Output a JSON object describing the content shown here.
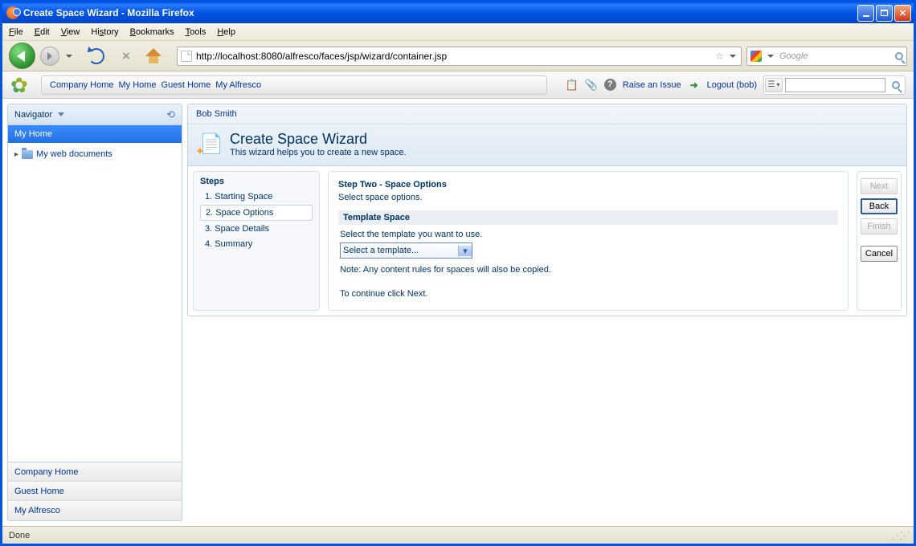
{
  "window": {
    "title": "Create Space Wizard - Mozilla Firefox"
  },
  "menubar": {
    "file": "File",
    "edit": "Edit",
    "view": "View",
    "history": "History",
    "bookmarks": "Bookmarks",
    "tools": "Tools",
    "help": "Help"
  },
  "url": "http://localhost:8080/alfresco/faces/jsp/wizard/container.jsp",
  "search_placeholder": "Google",
  "breadcrumbs": [
    "Company Home",
    "My Home",
    "Guest Home",
    "My Alfresco"
  ],
  "top_tools": {
    "raise_issue": "Raise an Issue",
    "logout": "Logout (bob)"
  },
  "sidebar": {
    "header": "Navigator",
    "active": "My Home",
    "tree_item": "My web documents",
    "bottom_links": [
      "Company Home",
      "Guest Home",
      "My Alfresco"
    ]
  },
  "main": {
    "breadcrumb": "Bob Smith",
    "title": "Create Space Wizard",
    "subtitle": "This wizard helps you to create a new space.",
    "steps_title": "Steps",
    "steps": [
      "1. Starting Space",
      "2. Space Options",
      "3. Space Details",
      "4. Summary"
    ],
    "active_step_index": 1,
    "step_title": "Step Two - Space Options",
    "step_desc": "Select space options.",
    "section_title": "Template Space",
    "instruction": "Select the template you want to use.",
    "select_value": "Select a template...",
    "note": "Note: Any content rules for spaces will also be copied.",
    "continue_hint": "To continue click Next."
  },
  "buttons": {
    "next": "Next",
    "back": "Back",
    "finish": "Finish",
    "cancel": "Cancel"
  },
  "status": "Done"
}
